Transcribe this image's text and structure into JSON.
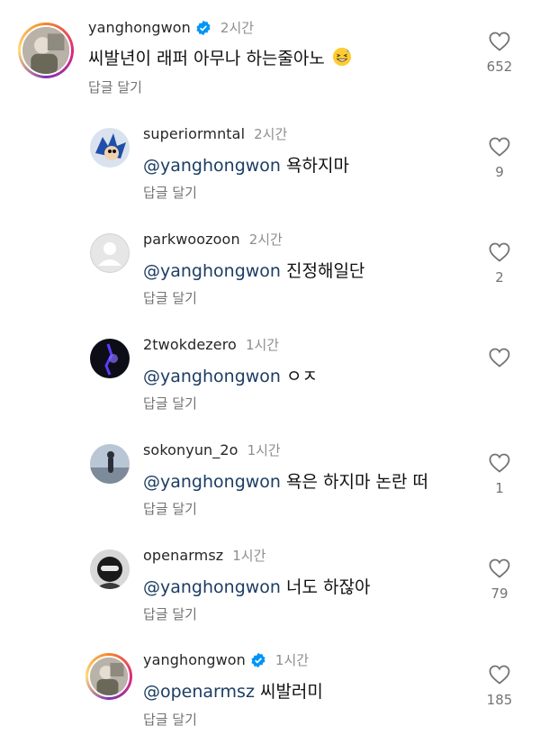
{
  "comments": [
    {
      "username": "yanghongwon",
      "verified": true,
      "time": "2시간",
      "mention": "",
      "text": "씨발년이 래퍼 아무나 하는줄아노",
      "emoji": "grinning-sweat-emoji",
      "reply": "답글 달기",
      "likes": "652",
      "avatar": "story-avatar-photo"
    },
    {
      "username": "superiormntal",
      "verified": false,
      "time": "2시간",
      "mention": "@yanghongwon",
      "text": " 욕하지마",
      "reply": "답글 달기",
      "likes": "9",
      "avatar": "sonic-avatar"
    },
    {
      "username": "parkwoozoon",
      "verified": false,
      "time": "2시간",
      "mention": "@yanghongwon",
      "text": " 진정해일단",
      "reply": "답글 달기",
      "likes": "2",
      "avatar": "default-avatar"
    },
    {
      "username": "2twokdezero",
      "verified": false,
      "time": "1시간",
      "mention": "@yanghongwon",
      "text": " ㅇㅈ",
      "reply": "답글 달기",
      "likes": "",
      "avatar": "dark-avatar"
    },
    {
      "username": "sokonyun_2o",
      "verified": false,
      "time": "1시간",
      "mention": "@yanghongwon",
      "text": " 욕은 하지마 논란 떠",
      "reply": "답글 달기",
      "likes": "1",
      "avatar": "sky-avatar"
    },
    {
      "username": "openarmsz",
      "verified": false,
      "time": "1시간",
      "mention": "@yanghongwon",
      "text": " 너도 하잖아",
      "reply": "답글 달기",
      "likes": "79",
      "avatar": "mask-avatar"
    },
    {
      "username": "yanghongwon",
      "verified": true,
      "time": "1시간",
      "mention": "@openarmsz",
      "text": " 씨발러미",
      "reply": "답글 달기",
      "likes": "185",
      "avatar": "story-avatar-photo"
    }
  ],
  "colors": {
    "mention": "#1c3d63",
    "verified": "#0095f6",
    "muted": "#737373"
  }
}
